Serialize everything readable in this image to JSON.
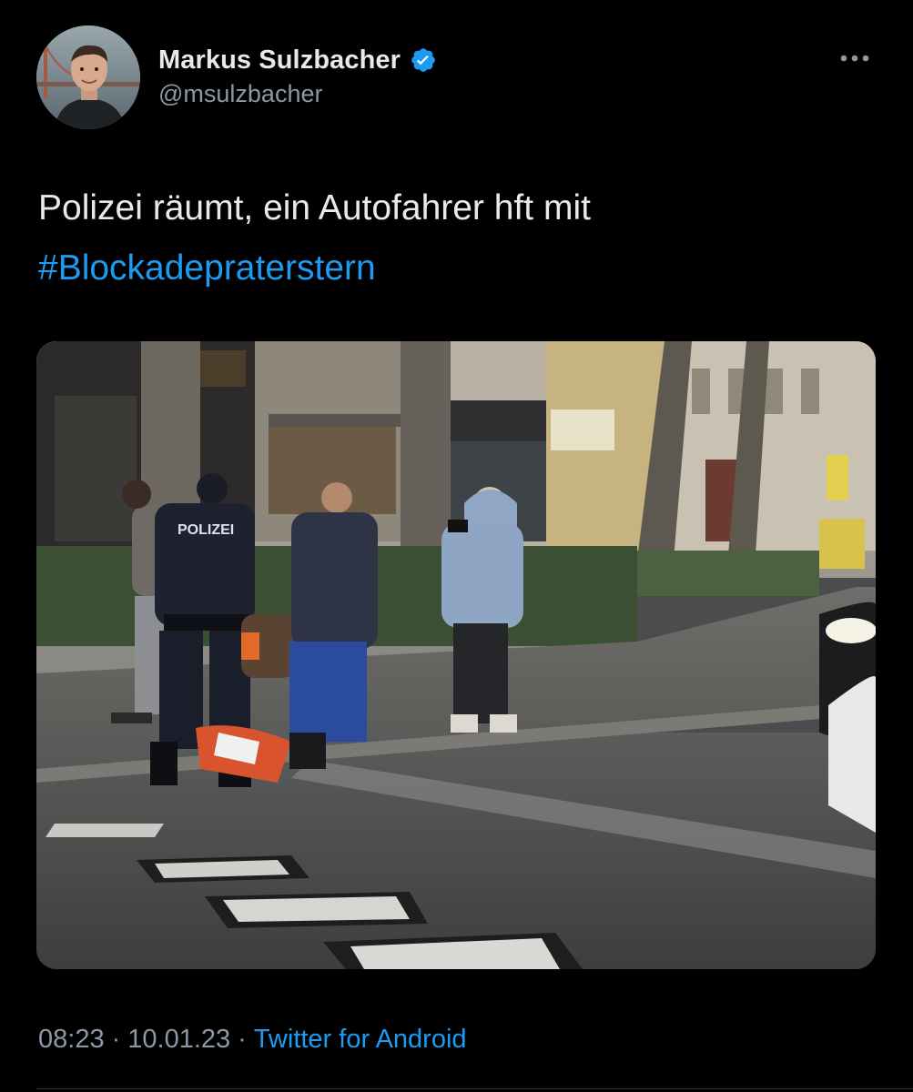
{
  "author": {
    "display_name": "Markus Sulzbacher",
    "handle": "@msulzbacher",
    "verified": true
  },
  "tweet": {
    "text": "Polizei räumt, ein Autofahrer hft mit",
    "hashtag": "#Blockadepraterstern"
  },
  "meta": {
    "time": "08:23",
    "dot1": "·",
    "date": "10.01.23",
    "dot2": "·",
    "source": "Twitter for Android"
  },
  "photo": {
    "police_back_text": "POLIZEI"
  },
  "colors": {
    "background": "#000000",
    "text": "#e7e9ea",
    "secondary_text": "#8b98a5",
    "link": "#1d9bf0",
    "verified_badge": "#1d9bf0"
  },
  "icons": {
    "verified": "verified-badge-icon",
    "more": "more-options-icon"
  }
}
